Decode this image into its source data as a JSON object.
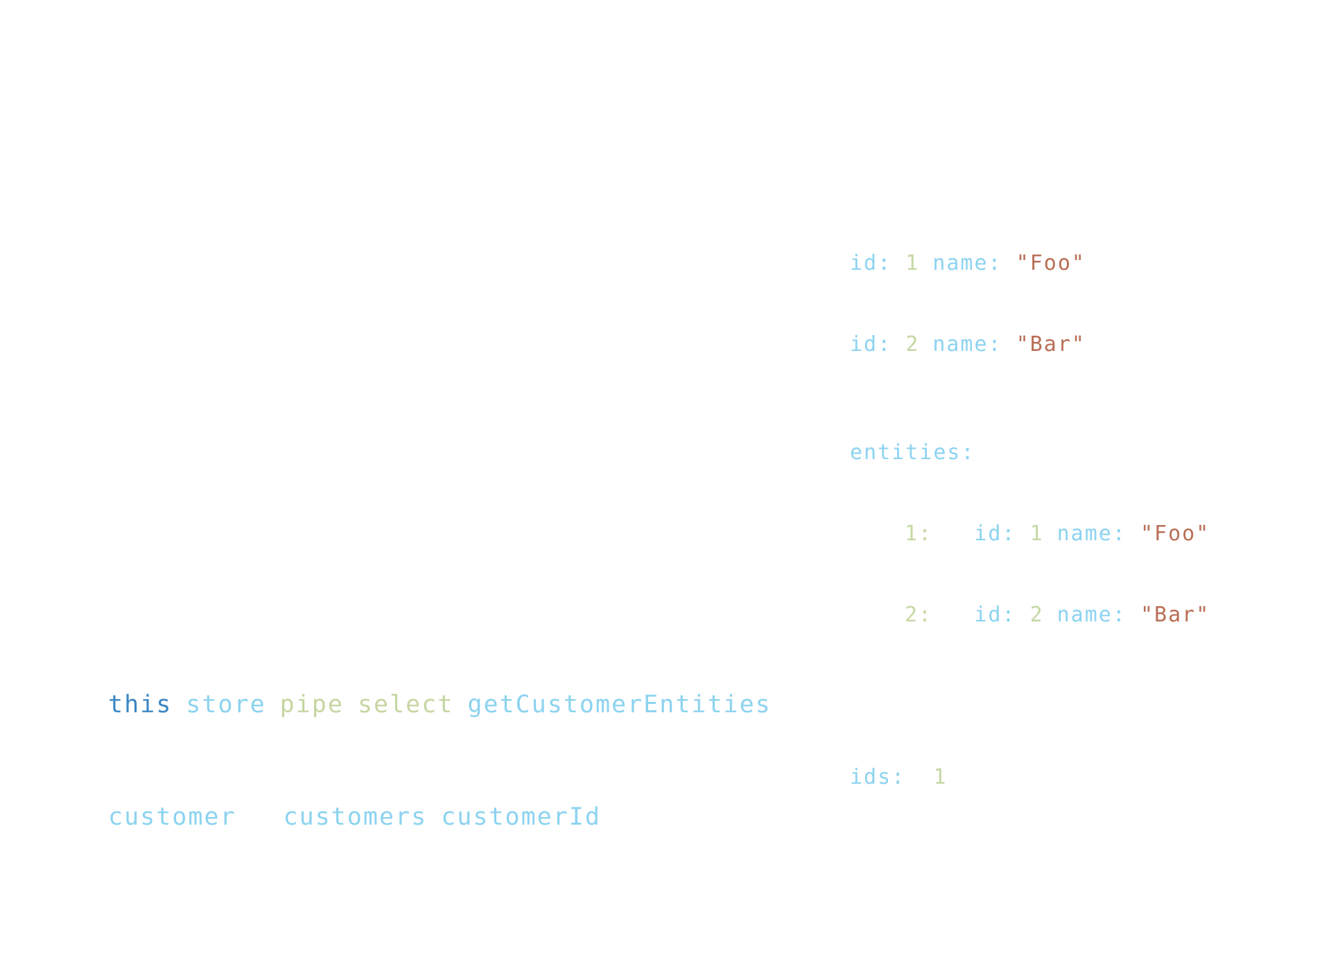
{
  "colors": {
    "keyword": "#3b86c4",
    "identifier": "#8cd3f0",
    "number": "#c6d8a4",
    "method": "#c5d6a0",
    "string": "#b96e55"
  },
  "array_view": {
    "rows": [
      {
        "id_key": "id:",
        "id_value": "1",
        "name_key": "name:",
        "name_value": "\"Foo\""
      },
      {
        "id_key": "id:",
        "id_value": "2",
        "name_key": "name:",
        "name_value": "\"Bar\""
      }
    ]
  },
  "entity_view": {
    "entities_key": "entities:",
    "entities": [
      {
        "key": "1:",
        "id_key": "id:",
        "id_value": "1",
        "name_key": "name:",
        "name_value": "\"Foo\""
      },
      {
        "key": "2:",
        "id_key": "id:",
        "id_value": "2",
        "name_key": "name:",
        "name_value": "\"Bar\""
      }
    ],
    "ids_key": "ids:",
    "ids_value": "1"
  },
  "code": {
    "line1": [
      "this",
      "store",
      "pipe",
      "select",
      "getCustomerEntities"
    ],
    "line2": [
      "customer",
      "customers",
      "customerId"
    ]
  }
}
